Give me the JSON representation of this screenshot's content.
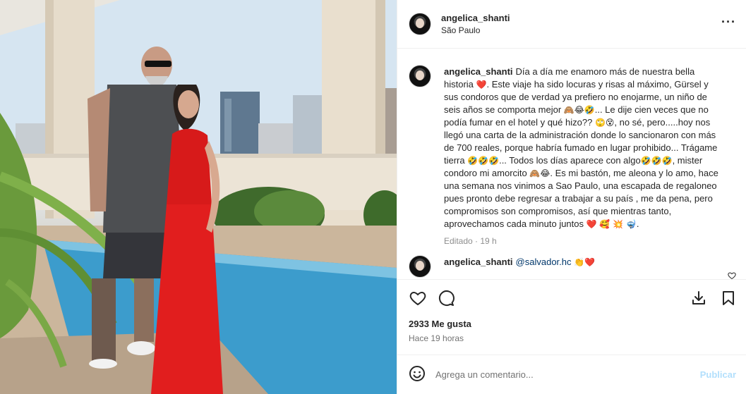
{
  "post": {
    "author": "angelica_shanti",
    "location": "São Paulo",
    "more_icon": "more-horizontal-icon"
  },
  "caption": {
    "author": "angelica_shanti",
    "parts": [
      "Día a día me enamoro más de nuestra bella historia",
      "❤️",
      ". Este viaje ha sido locuras y risas al máximo, Gürsel y sus condoros que de verdad ya prefiero no enojarme, un niño de seis años se comporta mejor",
      "🙈😂🤣",
      "... Le dije cien veces que no podía fumar en el hotel y qué hizo??",
      "🙄😵",
      ", no sé, pero.....hoy nos llegó una carta de la administración donde lo sancionaron con más de 700 reales, porque habría fumado en lugar prohibido... Trágame tierra",
      "🤣🤣🤣",
      "... Todos los días aparece con algo",
      "🤣🤣🤣",
      ", mister condoro mi amorcito",
      "🙈😂",
      ". Es mi bastón, me aleona y lo amo, hace una semana nos vinimos a Sao Paulo, una escapada de regaloneo pues pronto debe regresar a trabajar a su país , me da pena, pero compromisos son compromisos, así que mientras tanto, aprovechamos cada minuto juntos",
      "❤️ 🥰 💥 🤿",
      "."
    ],
    "time": "Editado · 19 h"
  },
  "reply": {
    "author": "angelica_shanti",
    "mention": "@salvador.hc",
    "emojis": "👏❤️"
  },
  "stats": {
    "likes": "2933 Me gusta",
    "ago": "Hace 19 horas"
  },
  "composer": {
    "placeholder": "Agrega un comentario...",
    "publish": "Publicar"
  },
  "colors": {
    "like_red": "#e0245e",
    "link": "#00376b",
    "publish_disabled": "#b2dffc"
  }
}
